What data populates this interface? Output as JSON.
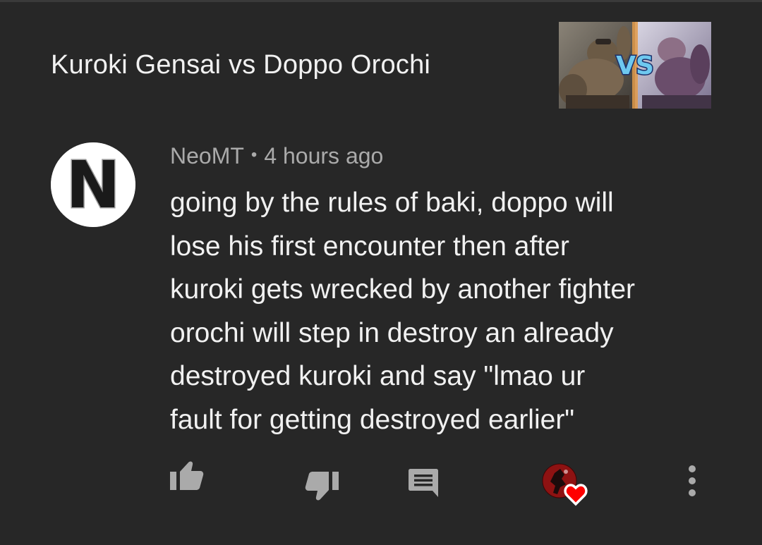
{
  "video": {
    "title": "Kuroki Gensai vs Doppo Orochi",
    "thumbnail_text": "VS"
  },
  "comment": {
    "author": "NeoMT",
    "separator": "•",
    "time": "4 hours ago",
    "avatar_letter": "N",
    "lines": [
      "going by the rules of baki, doppo will",
      "lose his first encounter then after",
      "kuroki gets wrecked by another fighter",
      "orochi will step in destroy an already",
      "destroyed kuroki and say \"lmao ur",
      "fault for getting destroyed earlier\""
    ]
  },
  "actions": {
    "like_icon": "thumb-up-icon",
    "dislike_icon": "thumb-down-icon",
    "reply_icon": "comment-icon",
    "heart_icon": "creator-heart-icon",
    "more_icon": "more-vert-icon"
  },
  "colors": {
    "background": "#272727",
    "primary_text": "#f1f1f1",
    "secondary_text": "#aaaaaa",
    "icon": "#aaaaaa",
    "heart": "#ff0000"
  }
}
